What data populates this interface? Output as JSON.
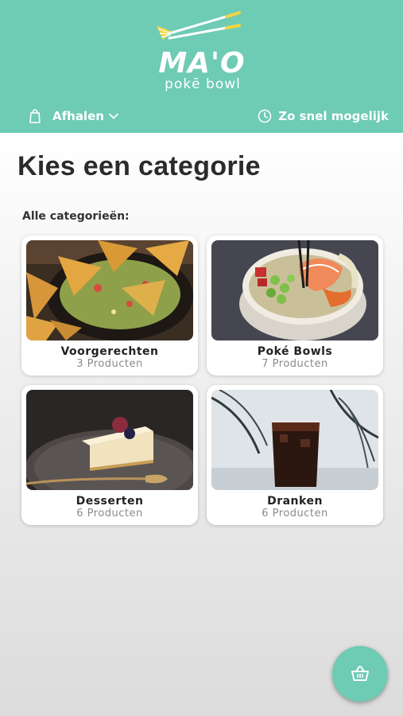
{
  "brand": {
    "name": "MA'O",
    "subtitle": "pokē bowl",
    "color": "#6ecbb4",
    "accent": "#f2d544"
  },
  "order": {
    "type_label": "Afhalen",
    "time_label": "Zo snel mogelijk",
    "type_icon": "bag-icon",
    "time_icon": "clock-icon"
  },
  "page_title": "Kies een categorie",
  "section_label": "Alle categorieën:",
  "categories": [
    {
      "name": "Voorgerechten",
      "count": "3 Producten",
      "image": "nachos-guacamole"
    },
    {
      "name": "Poké Bowls",
      "count": "7 Producten",
      "image": "poke-bowl-salmon"
    },
    {
      "name": "Desserten",
      "count": "6 Producten",
      "image": "cheesecake"
    },
    {
      "name": "Dranken",
      "count": "6 Producten",
      "image": "cola-glass"
    }
  ],
  "cart": {
    "icon": "basket-icon"
  }
}
